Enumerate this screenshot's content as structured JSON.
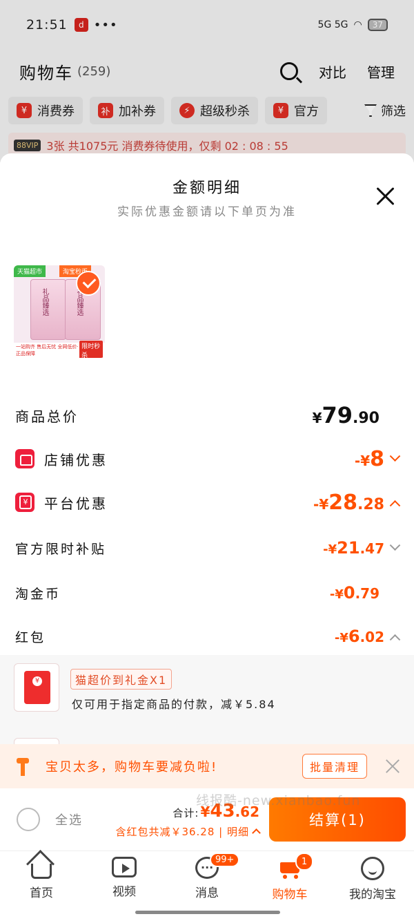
{
  "status_bar": {
    "time": "21:51",
    "app_badge": "d",
    "dots": "•••",
    "right_icons": "5G 5G",
    "battery": "37"
  },
  "cart_header": {
    "title": "购物车",
    "count": "(259)",
    "compare_label": "对比",
    "manage_label": "管理"
  },
  "filters": {
    "chips": [
      {
        "icon": "¥",
        "label": "消费券"
      },
      {
        "icon": "补",
        "label": "加补券"
      },
      {
        "icon": "⚡",
        "label": "超级秒杀"
      },
      {
        "icon": "¥",
        "label": "官方"
      }
    ],
    "filter_label": "筛选"
  },
  "vip_strip": {
    "badge": "88VIP",
    "text": "3张 共1075元 消费券待使用，仅剩 02 : 08 : 55"
  },
  "sheet": {
    "title": "金额明细",
    "subtitle": "实际优惠金额请以下单页为准",
    "product": {
      "tag_left": "天猫超市",
      "tag_right": "淘宝秒币",
      "bag_text": "礼品臻选",
      "footer_text": "一站购齐 售后无忧 全网低价·正品保障",
      "flash_label": "限时秒杀"
    },
    "rows": {
      "total": {
        "label": "商品总价",
        "cur": "¥",
        "int": "79",
        "dec": ".90"
      },
      "store": {
        "label": "店铺优惠",
        "cur": "-¥",
        "int": "8",
        "dec": ""
      },
      "platform": {
        "label": "平台优惠",
        "cur": "-¥",
        "int": "28",
        "dec": ".28"
      },
      "subsidy": {
        "label": "官方限时补贴",
        "cur": "-¥",
        "int": "21",
        "dec": ".47"
      },
      "coins": {
        "label": "淘金币",
        "cur": "-¥",
        "int": "0",
        "dec": ".79"
      },
      "redpack": {
        "label": "红包",
        "cur": "-¥",
        "int": "6",
        "dec": ".02"
      }
    },
    "redpack_detail": {
      "tag": "猫超价到礼金X1",
      "desc": "仅可用于指定商品的付款，减￥5.84"
    }
  },
  "notice": {
    "text": "宝贝太多，购物车要减负啦!",
    "button": "批量清理"
  },
  "checkout": {
    "select_all": "全选",
    "total_label": "合计:",
    "total_cur": "¥",
    "total_int": "43",
    "total_dec": ".62",
    "discount_line": "含红包共减￥36.28 | 明细",
    "button": "结算(1)"
  },
  "watermark": "线报酷-new.xianbao.fun",
  "tabbar": {
    "tabs": [
      {
        "label": "首页",
        "icon": "home-icon"
      },
      {
        "label": "视频",
        "icon": "video-icon"
      },
      {
        "label": "消息",
        "icon": "message-icon",
        "badge": "99+"
      },
      {
        "label": "购物车",
        "icon": "cart-icon",
        "badge": "1",
        "active": true
      },
      {
        "label": "我的淘宝",
        "icon": "profile-icon"
      }
    ]
  },
  "colors": {
    "accent": "#ff5000",
    "red": "#ee1f3c"
  }
}
